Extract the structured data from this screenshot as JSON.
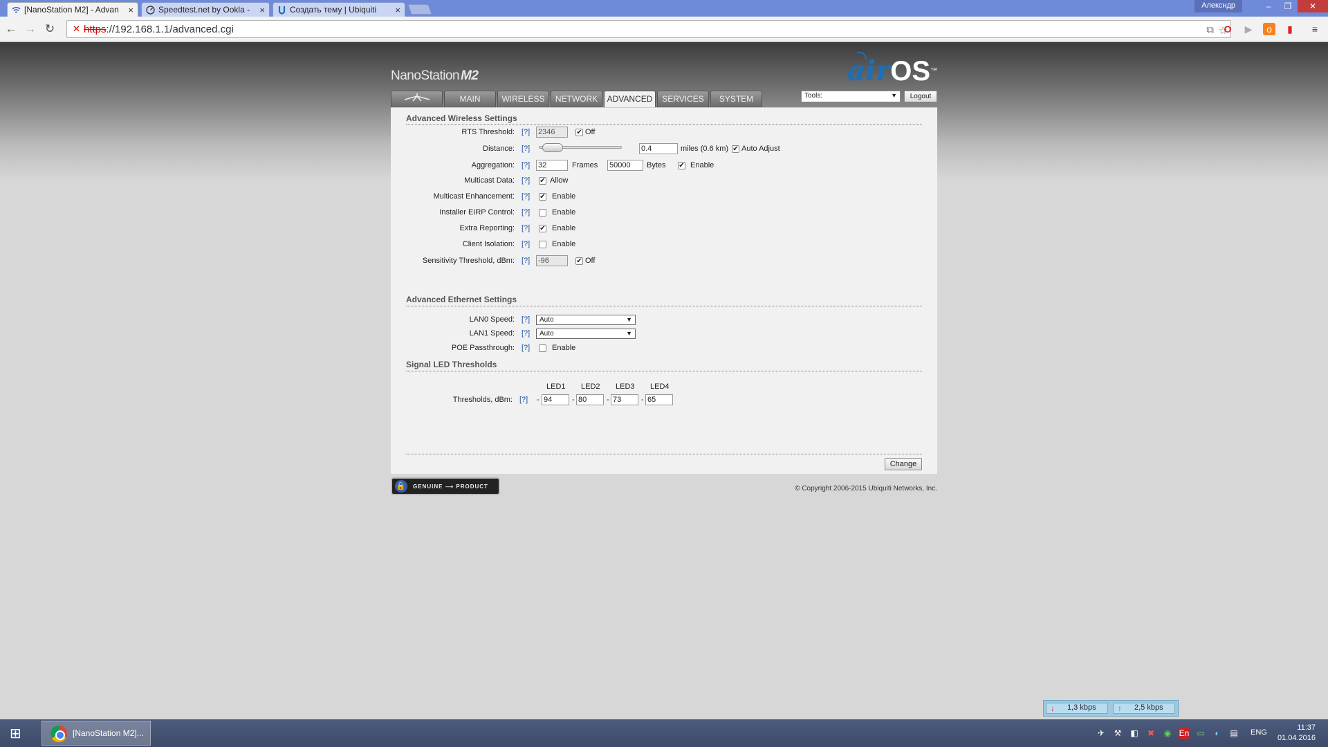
{
  "browser": {
    "tabs": [
      {
        "title": "[NanoStation M2] - Advan",
        "icon": "wifi-icon",
        "active": true
      },
      {
        "title": "Speedtest.net by Ookla -",
        "icon": "speedometer-icon",
        "active": false
      },
      {
        "title": "Создать тему | Ubiquiti",
        "icon": "ubiquiti-icon",
        "active": false
      }
    ],
    "user": "Алексндр",
    "url_scheme": "https",
    "url_rest": "://192.168.1.1/advanced.cgi"
  },
  "header": {
    "product": "NanoStation",
    "model": "M2",
    "logo_air": "air",
    "logo_os": "OS",
    "logo_tm": "™"
  },
  "nav": {
    "tabs": [
      "MAIN",
      "WIRELESS",
      "NETWORK",
      "ADVANCED",
      "SERVICES",
      "SYSTEM"
    ],
    "active": "ADVANCED",
    "tools_label": "Tools:",
    "logout_label": "Logout"
  },
  "wireless": {
    "title": "Advanced Wireless Settings",
    "help": "[?]",
    "rts": {
      "label": "RTS Threshold:",
      "value": "2346",
      "off_label": "Off",
      "off_checked": true
    },
    "distance": {
      "label": "Distance:",
      "value": "0.4",
      "unit": "miles (0.6 km)",
      "auto_label": "Auto Adjust",
      "auto_checked": true,
      "slider_fraction": 0.05
    },
    "aggregation": {
      "label": "Aggregation:",
      "frames": "32",
      "frames_unit": "Frames",
      "bytes": "50000",
      "bytes_unit": "Bytes",
      "enable_label": "Enable",
      "enabled": true
    },
    "multicast_data": {
      "label": "Multicast Data:",
      "option": "Allow",
      "checked": true
    },
    "multicast_enh": {
      "label": "Multicast Enhancement:",
      "option": "Enable",
      "checked": true
    },
    "eirp": {
      "label": "Installer EIRP Control:",
      "option": "Enable",
      "checked": false
    },
    "extra_reporting": {
      "label": "Extra Reporting:",
      "option": "Enable",
      "checked": true
    },
    "client_isolation": {
      "label": "Client Isolation:",
      "option": "Enable",
      "checked": false
    },
    "sensitivity": {
      "label": "Sensitivity Threshold, dBm:",
      "value": "-96",
      "off_label": "Off",
      "off_checked": true
    }
  },
  "ethernet": {
    "title": "Advanced Ethernet Settings",
    "lan0": {
      "label": "LAN0 Speed:",
      "value": "Auto"
    },
    "lan1": {
      "label": "LAN1 Speed:",
      "value": "Auto"
    },
    "poe": {
      "label": "POE Passthrough:",
      "option": "Enable",
      "checked": false
    }
  },
  "led": {
    "title": "Signal LED Thresholds",
    "headers": [
      "LED1",
      "LED2",
      "LED3",
      "LED4"
    ],
    "label": "Thresholds, dBm:",
    "values": [
      "94",
      "80",
      "73",
      "65"
    ],
    "prefix": "-"
  },
  "footer": {
    "change_label": "Change",
    "genuine": "GENUINE ⟶ PRODUCT",
    "copyright": "© Copyright 2006-2015 Ubiquiti Networks, Inc."
  },
  "bandwidth": {
    "down": "1,3 kbps",
    "up": "2,5 kbps"
  },
  "taskbar": {
    "task": "[NanoStation M2]...",
    "lang": "ENG",
    "time": "11:37",
    "date": "01.04.2016"
  }
}
